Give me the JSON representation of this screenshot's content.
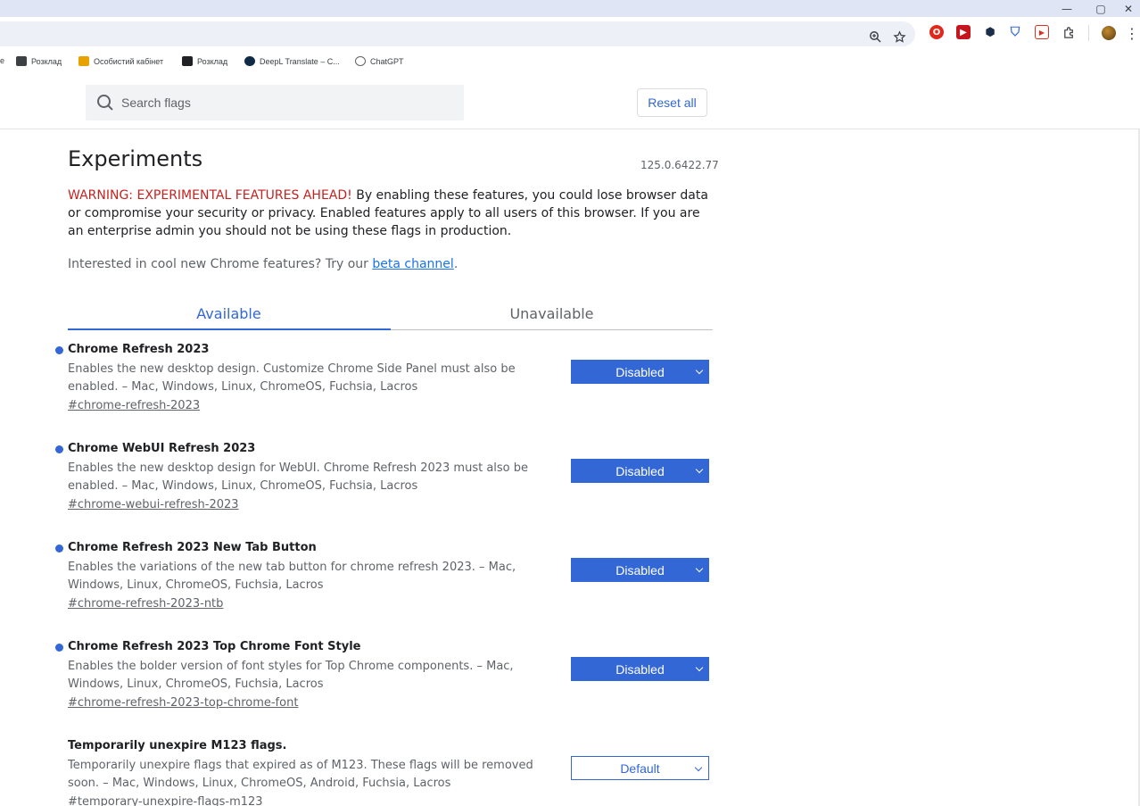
{
  "window": {
    "minimize_glyph": "—",
    "maximize_glyph": "▢",
    "close_glyph": "✕"
  },
  "toolbar": {
    "zoom_icon": "zoom-icon",
    "bookmark_icon": "star-icon",
    "menu_glyph": "⋮",
    "extensions": [
      {
        "name": "opera-extension-icon",
        "color": "#e0281b",
        "glyph": "O"
      },
      {
        "name": "youtube-extension-icon",
        "color": "#c4161c",
        "glyph": "▶"
      },
      {
        "name": "hex-extension-icon",
        "color": "#1c2d4a",
        "glyph": "⬢"
      },
      {
        "name": "shield-extension-icon",
        "color": "#3b6fd6",
        "glyph": "⛉"
      },
      {
        "name": "media-extension-icon",
        "color": "#d93025",
        "glyph": "▶"
      }
    ]
  },
  "bookmarks": [
    {
      "label": "e",
      "color": "#5f6368"
    },
    {
      "label": "Розклад",
      "color": "#3c4043"
    },
    {
      "label": "Особистий кабінет",
      "color": "#e8a200"
    },
    {
      "label": "Розклад",
      "color": "#202124"
    },
    {
      "label": "DeepL Translate – C...",
      "color": "#0f2b46"
    },
    {
      "label": "ChatGPT",
      "color": "#5f6368"
    }
  ],
  "header": {
    "search_placeholder": "Search flags",
    "reset_label": "Reset all"
  },
  "page": {
    "title": "Experiments",
    "version": "125.0.6422.77",
    "warning_prefix": "WARNING: EXPERIMENTAL FEATURES AHEAD!",
    "warning_body": " By enabling these features, you could lose browser data or compromise your security or privacy. Enabled features apply to all users of this browser. If you are an enterprise admin you should not be using these flags in production.",
    "interested_text": "Interested in cool new Chrome features? Try our ",
    "beta_link": "beta channel",
    "interested_suffix": "."
  },
  "tabs": {
    "available": "Available",
    "unavailable": "Unavailable"
  },
  "flags": [
    {
      "name": "Chrome Refresh 2023",
      "description": "Enables the new desktop design. Customize Chrome Side Panel must also be enabled. – Mac, Windows, Linux, ChromeOS, Fuchsia, Lacros",
      "link": "#chrome-refresh-2023",
      "value": "Disabled"
    },
    {
      "name": "Chrome WebUI Refresh 2023",
      "description": "Enables the new desktop design for WebUI. Chrome Refresh 2023 must also be enabled. – Mac, Windows, Linux, ChromeOS, Fuchsia, Lacros",
      "link": "#chrome-webui-refresh-2023",
      "value": "Disabled"
    },
    {
      "name": "Chrome Refresh 2023 New Tab Button",
      "description": "Enables the variations of the new tab button for chrome refresh 2023. – Mac, Windows, Linux, ChromeOS, Fuchsia, Lacros",
      "link": "#chrome-refresh-2023-ntb",
      "value": "Disabled"
    },
    {
      "name": "Chrome Refresh 2023 Top Chrome Font Style",
      "description": "Enables the bolder version of font styles for Top Chrome components. – Mac, Windows, Linux, ChromeOS, Fuchsia, Lacros",
      "link": "#chrome-refresh-2023-top-chrome-font",
      "value": "Disabled"
    },
    {
      "name": "Temporarily unexpire M123 flags.",
      "description": "Temporarily unexpire flags that expired as of M123. These flags will be removed soon. – Mac, Windows, Linux, ChromeOS, Android, Fuchsia, Lacros",
      "link": "#temporary-unexpire-flags-m123",
      "value": "Default"
    }
  ]
}
